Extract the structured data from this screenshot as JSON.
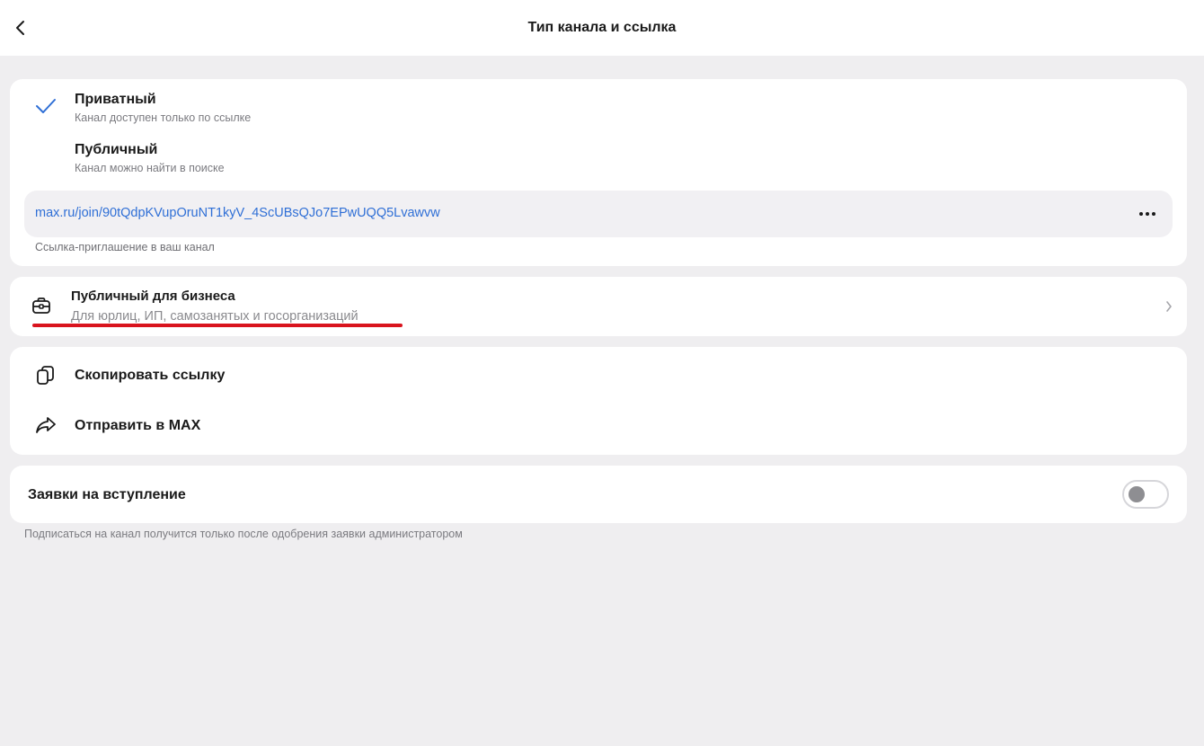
{
  "header": {
    "title": "Тип канала и ссылка",
    "back_icon": "chevron-left-icon"
  },
  "privacy": {
    "options": [
      {
        "title": "Приватный",
        "subtitle": "Канал доступен только по ссылке",
        "selected": true
      },
      {
        "title": "Публичный",
        "subtitle": "Канал можно найти в поиске",
        "selected": false
      }
    ],
    "link": "max.ru/join/90tQdpKVupOruNT1kyV_4ScUBsQJo7EPwUQQ5Lvawvw",
    "link_caption": "Ссылка-приглашение в ваш канал"
  },
  "business": {
    "title": "Публичный для бизнеса",
    "subtitle": "Для юрлиц, ИП, самозанятых и госорганизаций",
    "icon": "briefcase-icon",
    "underline_color": "#d9141e"
  },
  "actions": [
    {
      "label": "Скопировать ссылку",
      "icon": "copy-icon"
    },
    {
      "label": "Отправить в MAX",
      "icon": "share-arrow-icon"
    }
  ],
  "requests": {
    "label": "Заявки на вступление",
    "enabled": false,
    "caption": "Подписаться на канал получится только после одобрения заявки администратором"
  },
  "colors": {
    "accent": "#2f6fd6",
    "background": "#efeef0",
    "card": "#ffffff"
  }
}
